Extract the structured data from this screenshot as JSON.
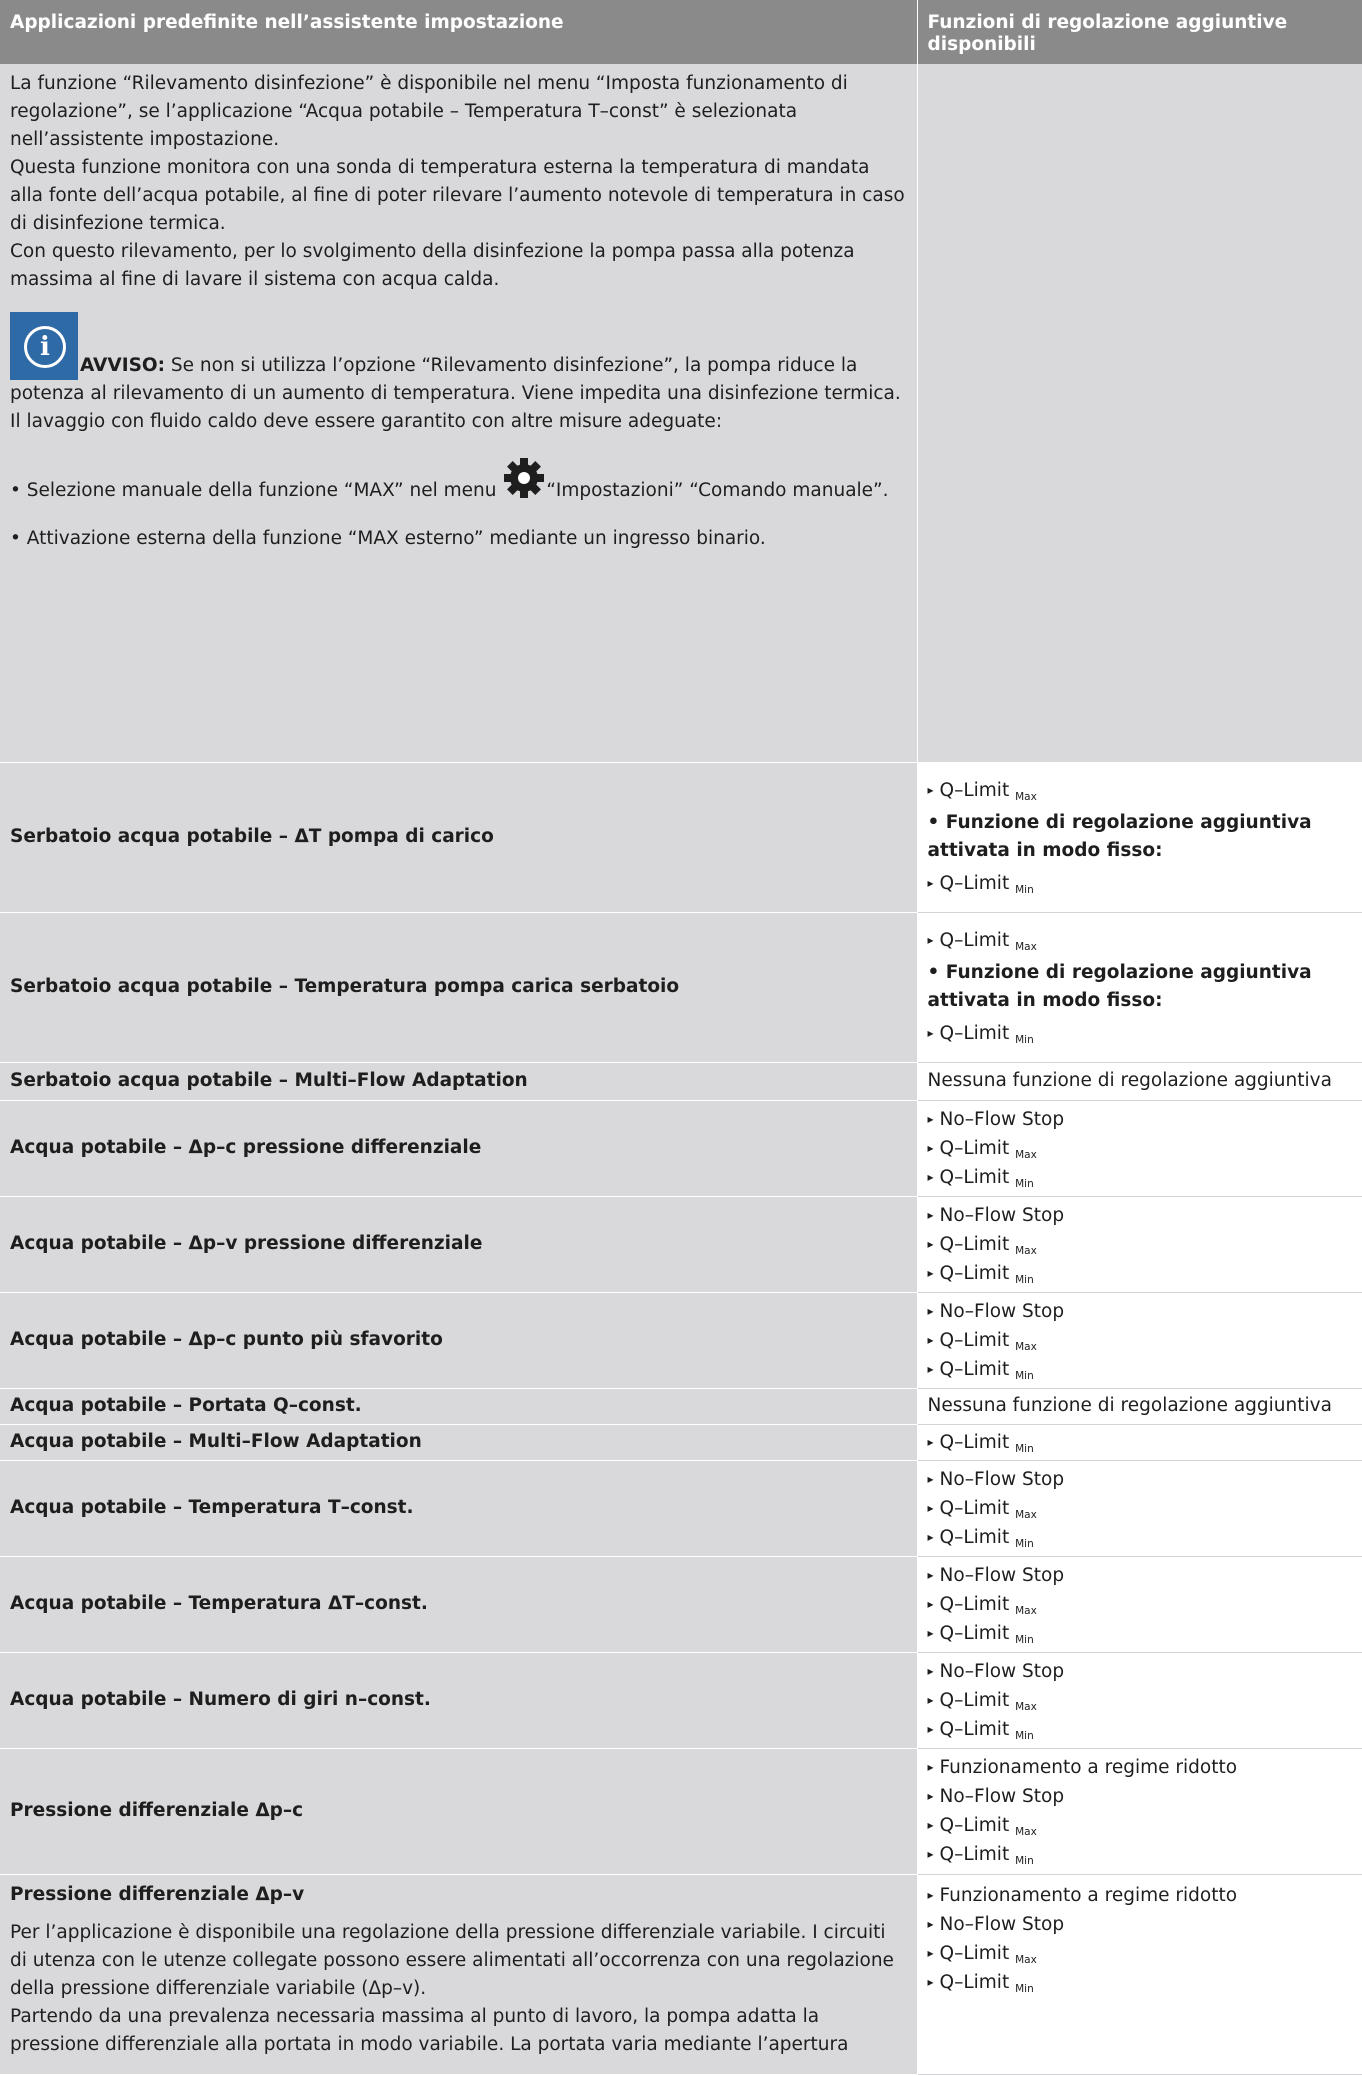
{
  "header": {
    "col1": "Applicazioni predefinite nell’assistente impostazione",
    "col2": "Funzioni di regolazione aggiuntive disponibili"
  },
  "intro": {
    "p1": "La funzione “Rilevamento disinfezione” è disponibile nel menu “Imposta funzionamento di regolazione”, se l’applicazione “Acqua potabile – Temperatura T–const” è selezionata nell’assistente impostazione.",
    "p2": "Questa funzione monitora con una sonda di temperatura esterna la temperatura di mandata alla fonte dell’acqua potabile, al fine di poter rilevare l’aumento notevole di temperatura in caso di disinfezione termica.",
    "p3": "Con questo rilevamento, per lo svolgimento della disinfezione la pompa passa alla potenza massima al fine di lavare il sistema con acqua calda.",
    "notice_label": "AVVISO:",
    "notice_text": " Se non si utilizza l’opzione “Rilevamento disinfezione”, la pompa riduce la potenza al rilevamento di un aumento di temperatura. Viene impedita una disinfezione termica.",
    "p4": "Il lavaggio con fluido caldo deve essere garantito con altre misure adeguate:",
    "b1_pre": "• Selezione manuale della funzione “MAX” nel menu ",
    "b1_post": "“Impostazioni” “Comando manuale”.",
    "b2": "• Attivazione esterna della funzione “MAX esterno” mediante un ingresso binario."
  },
  "common": {
    "qlimit": "Q–Limit",
    "max": "Max",
    "min": "Min",
    "noflow": "No–Flow Stop",
    "regime": "Funzionamento a regime ridotto",
    "nessuna": "Nessuna funzione di regolazione aggiuntiva",
    "fixed": "• Funzione di regolazione aggiuntiva attivata in modo fisso:"
  },
  "rows": [
    {
      "name": "Serbatoio acqua potabile – ΔT pompa di carico"
    },
    {
      "name": "Serbatoio acqua potabile – Temperatura pompa carica serbatoio"
    },
    {
      "name": "Serbatoio acqua potabile – Multi–Flow Adaptation"
    },
    {
      "name": "Acqua potabile – Δp–c pressione differenziale"
    },
    {
      "name": "Acqua potabile – Δp–v pressione differenziale"
    },
    {
      "name": "Acqua potabile – Δp–c punto più sfavorito"
    },
    {
      "name": "Acqua potabile – Portata Q–const."
    },
    {
      "name": "Acqua potabile – Multi–Flow Adaptation"
    },
    {
      "name": "Acqua potabile – Temperatura T–const."
    },
    {
      "name": "Acqua potabile – Temperatura ΔT–const."
    },
    {
      "name": "Acqua potabile – Numero di giri n–const."
    },
    {
      "name": "Pressione differenziale Δp–c"
    },
    {
      "name": "Pressione differenziale Δp–v",
      "desc1": "Per l’applicazione è disponibile una regolazione della pressione differenziale variabile. I circuiti di utenza con le utenze collegate possono essere alimentati all’occorrenza con una regolazione della pressione differenziale variabile (Δp–v).",
      "desc2": "Partendo da una prevalenza necessaria massima al punto di lavoro, la pompa adatta la pressione differenziale alla portata in modo variabile. La portata varia mediante l’apertura"
    }
  ]
}
